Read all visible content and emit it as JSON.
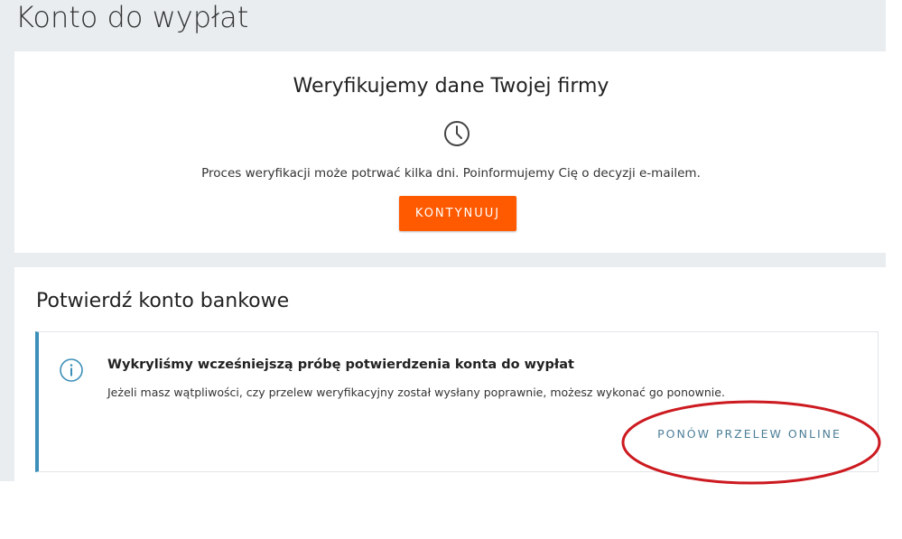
{
  "page": {
    "title": "Konto do wypłat"
  },
  "verification": {
    "heading": "Weryfikujemy dane Twojej firmy",
    "icon": "clock-icon",
    "description": "Proces weryfikacji może potrwać kilka dni. Poinformujemy Cię o decyzji e-mailem.",
    "continue_label": "KONTYNUUJ"
  },
  "bank": {
    "heading": "Potwierdź konto bankowe",
    "notice": {
      "icon": "info-icon",
      "title": "Wykryliśmy wcześniejszą próbę potwierdzenia konta do wypłat",
      "text": "Jeżeli masz wątpliwości, czy przelew weryfikacyjny został wysłany poprawnie, możesz wykonać go ponownie.",
      "retry_label": "PONÓW PRZELEW ONLINE"
    }
  },
  "colors": {
    "background": "#e9edf0",
    "accent_orange": "#ff5a00",
    "info_border": "#3c8fb8",
    "link_text": "#4c7e98",
    "annotation_red": "#cc1a20"
  }
}
